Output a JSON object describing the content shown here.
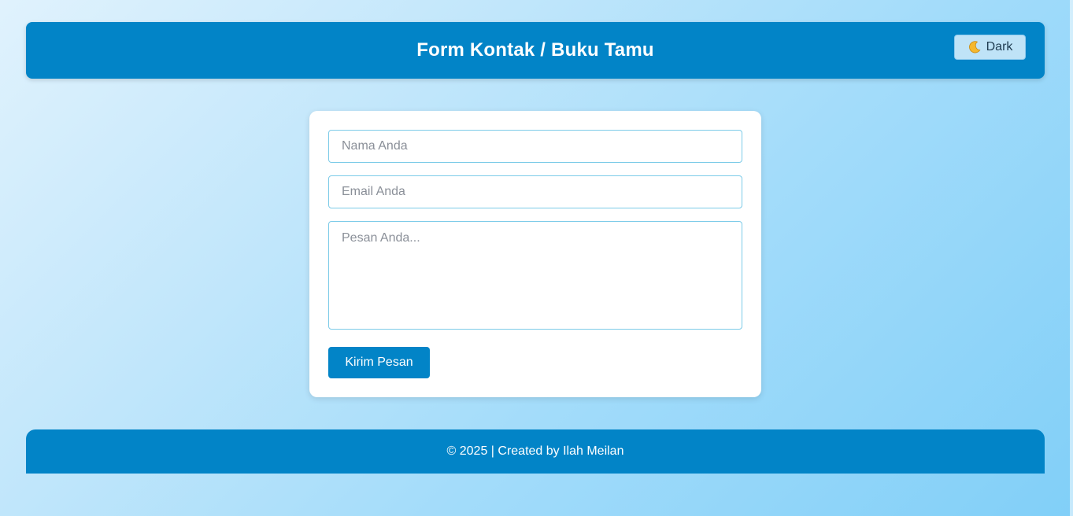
{
  "header": {
    "title": "Form Kontak / Buku Tamu",
    "theme_toggle": {
      "icon": "crescent-moon-icon",
      "label": "Dark"
    }
  },
  "form": {
    "name_placeholder": "Nama Anda",
    "email_placeholder": "Email Anda",
    "message_placeholder": "Pesan Anda...",
    "submit_label": "Kirim Pesan"
  },
  "footer": {
    "text": "© 2025 | Created by Ilah Meilan"
  },
  "colors": {
    "primary": "#0284c7",
    "input_border": "#7ccbe8",
    "toggle_bg": "#bfe3f7",
    "background_start": "#e0f2fd",
    "background_end": "#81cff8"
  }
}
